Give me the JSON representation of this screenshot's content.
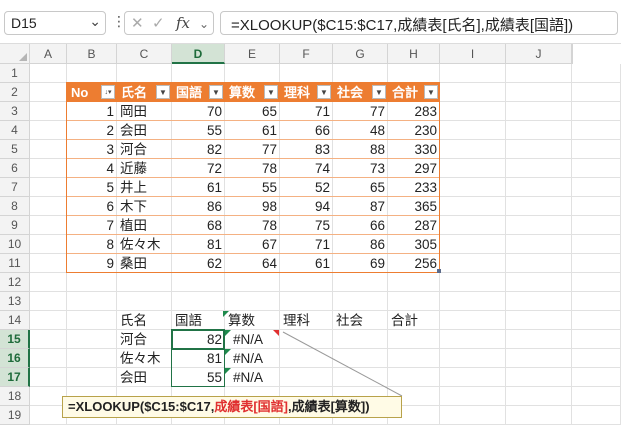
{
  "formula_bar": {
    "name_box": "D15",
    "formula": "=XLOOKUP($C15:$C17,成績表[氏名],成績表[国語])",
    "fx_label": "fx"
  },
  "columns": [
    "A",
    "B",
    "C",
    "D",
    "E",
    "F",
    "G",
    "H",
    "I",
    "J"
  ],
  "rows": [
    "1",
    "2",
    "3",
    "4",
    "5",
    "6",
    "7",
    "8",
    "9",
    "10",
    "11",
    "12",
    "13",
    "14",
    "15",
    "16",
    "17",
    "18",
    "19"
  ],
  "table": {
    "headers": [
      "No",
      "氏名",
      "国語",
      "算数",
      "理科",
      "社会",
      "合計"
    ],
    "rows": [
      [
        "1",
        "岡田",
        "70",
        "65",
        "71",
        "77",
        "283"
      ],
      [
        "2",
        "会田",
        "55",
        "61",
        "66",
        "48",
        "230"
      ],
      [
        "3",
        "河合",
        "82",
        "77",
        "83",
        "88",
        "330"
      ],
      [
        "4",
        "近藤",
        "72",
        "78",
        "74",
        "73",
        "297"
      ],
      [
        "5",
        "井上",
        "61",
        "55",
        "52",
        "65",
        "233"
      ],
      [
        "6",
        "木下",
        "86",
        "98",
        "94",
        "87",
        "365"
      ],
      [
        "7",
        "植田",
        "68",
        "78",
        "75",
        "66",
        "287"
      ],
      [
        "8",
        "佐々木",
        "81",
        "67",
        "71",
        "86",
        "305"
      ],
      [
        "9",
        "桑田",
        "62",
        "64",
        "61",
        "69",
        "256"
      ]
    ]
  },
  "lookup": {
    "headers": [
      "氏名",
      "国語",
      "算数",
      "理科",
      "社会",
      "合計"
    ],
    "rows": [
      [
        "河合",
        "82",
        "#N/A"
      ],
      [
        "佐々木",
        "81",
        "#N/A"
      ],
      [
        "会田",
        "55",
        "#N/A"
      ]
    ]
  },
  "callout": {
    "part1": "=XLOOKUP($C15:$C17,",
    "part2": "成績表[国語]",
    "part3": ",成績表[算数])"
  },
  "colors": {
    "table_header": "#ed7d31",
    "table_border": "#ed7d31",
    "selection": "#217346",
    "error_marker": "#e03030"
  }
}
